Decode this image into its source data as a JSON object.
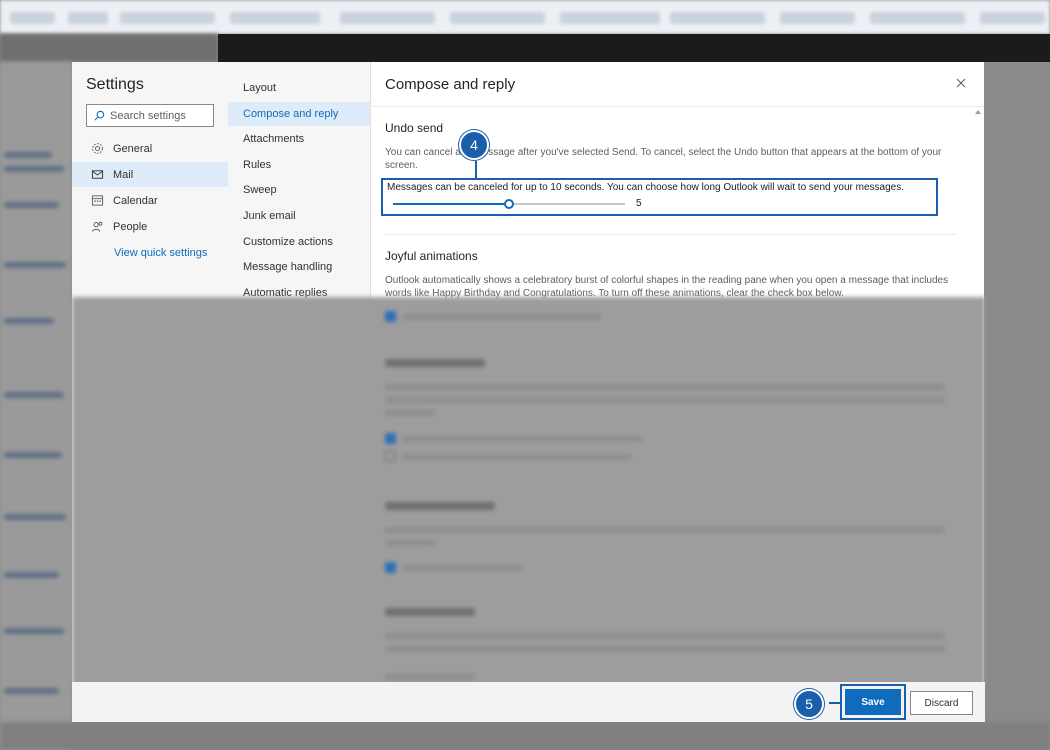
{
  "settings": {
    "title": "Settings",
    "search_placeholder": "Search settings",
    "nav": [
      {
        "label": "General",
        "icon": "gear-icon"
      },
      {
        "label": "Mail",
        "icon": "mail-icon"
      },
      {
        "label": "Calendar",
        "icon": "calendar-icon"
      },
      {
        "label": "People",
        "icon": "people-icon"
      }
    ],
    "active_nav": "Mail",
    "quick_settings": "View quick settings"
  },
  "subnav": {
    "items": [
      "Layout",
      "Compose and reply",
      "Attachments",
      "Rules",
      "Sweep",
      "Junk email",
      "Customize actions",
      "Message handling",
      "Automatic replies"
    ],
    "active": "Compose and reply"
  },
  "main": {
    "title": "Compose and reply",
    "undo": {
      "heading": "Undo send",
      "description": "You can cancel a message after you've selected Send. To cancel, select the Undo button that appears at the bottom of your screen.",
      "desc_line1": "You can cancel a",
      "desc_line1b": "message after you've selected Send. To cancel, select the Undo button that appears at the bottom of your",
      "desc_line2": "screen.",
      "label": "Messages can be canceled for up to 10 seconds. You can choose how long Outlook will wait to send your messages.",
      "slider_value": "5",
      "slider_max": 10
    },
    "joyful": {
      "heading": "Joyful animations",
      "desc_line1": "Outlook automatically shows a celebratory burst of colorful shapes in the reading pane when you open a message that includes",
      "desc_line2": "words like Happy Birthday and Congratulations. To turn off these animations, clear the check box below."
    }
  },
  "callouts": {
    "step4": "4",
    "step5": "5"
  },
  "footer": {
    "save": "Save",
    "discard": "Discard"
  },
  "colors": {
    "accent": "#0f6cbd",
    "callout": "#1b5eab",
    "active_nav_bg": "#deecf9"
  }
}
